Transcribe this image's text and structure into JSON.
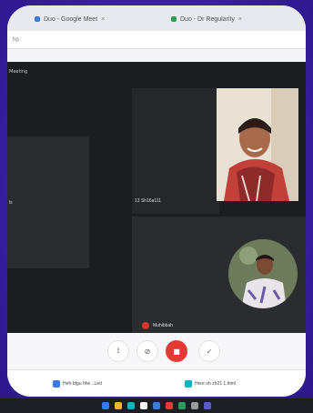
{
  "browser": {
    "tabs": [
      {
        "label": "Duo - Google Meet",
        "fav_color": "#3a7be0"
      },
      {
        "label": "Duo - Dr Regularity",
        "fav_color": "#2e9d5b"
      }
    ],
    "url": "hp"
  },
  "meeting": {
    "top_label": "Meeting",
    "left_tile_label": "ls",
    "tile_woman_label": "13 Sh16a111",
    "tile_presenter_label": "Muhibbah"
  },
  "controls": {
    "icons": [
      "mic-off-icon",
      "camera-off-icon",
      "end-call-icon",
      "raise-hand-icon"
    ]
  },
  "downloads": [
    {
      "label": "Hefr bfgu hhe...Led",
      "color": "#3a7be0"
    },
    {
      "label": "Here oh zh21 1.html",
      "color": "#00b7c3"
    }
  ]
}
